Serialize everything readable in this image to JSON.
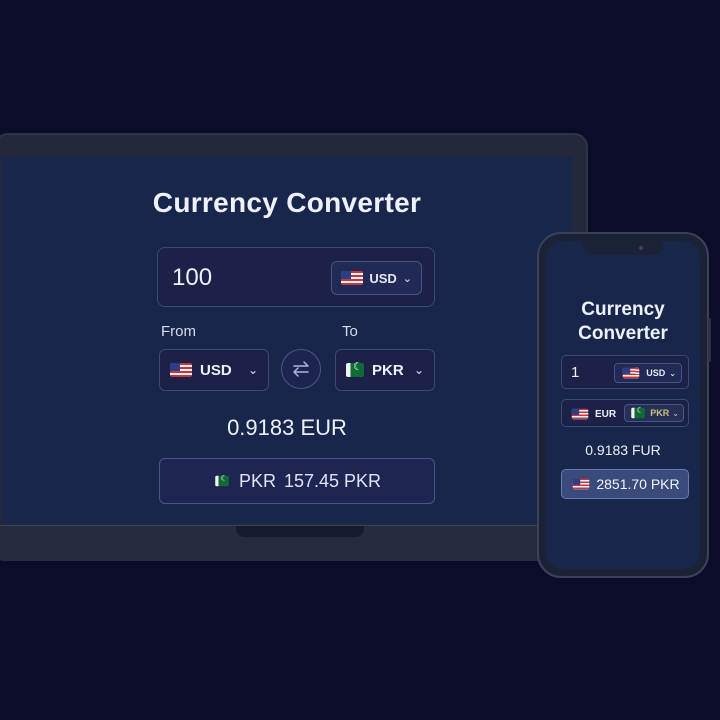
{
  "laptop": {
    "title": "Currency Converter",
    "amount": "100",
    "amount_currency": "USD",
    "from_label": "From",
    "to_label": "To",
    "from_currency": "USD",
    "to_currency": "PKR",
    "result": "0.9183 EUR",
    "convert_flag_label": "PKR",
    "convert_value": "157.45 PKR"
  },
  "phone": {
    "title_line1": "Currency",
    "title_line2": "Converter",
    "amount": "1",
    "amount_currency": "USD",
    "from_currency": "EUR",
    "to_currency": "PKR",
    "result": "0.9183 FUR",
    "convert_value": "2851.70 PKR"
  },
  "icons": {
    "swap": "swap-arrows-icon",
    "chevron": "chevron-down-icon"
  },
  "colors": {
    "background": "#0b0c2a",
    "screen": "#17264a",
    "field": "#1b2147",
    "border": "#3d4a78"
  }
}
